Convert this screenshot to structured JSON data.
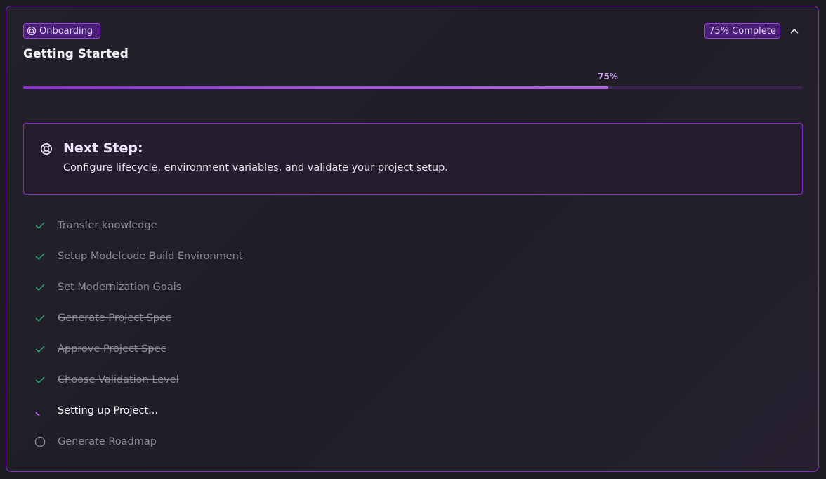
{
  "header": {
    "badge_label": "Onboarding",
    "complete_label": "75% Complete",
    "title": "Getting Started"
  },
  "progress": {
    "value_label": "75%",
    "fraction": 0.75
  },
  "next_step": {
    "title": "Next Step:",
    "description": "Configure lifecycle, environment variables, and validate your project setup."
  },
  "steps": [
    {
      "label": "Transfer knowledge",
      "status": "done",
      "icon": "check-icon"
    },
    {
      "label": "Setup Modelcode Build Environment",
      "status": "done",
      "icon": "check-icon"
    },
    {
      "label": "Set Modernization Goals",
      "status": "done",
      "icon": "check-icon"
    },
    {
      "label": "Generate Project Spec",
      "status": "done",
      "icon": "check-icon"
    },
    {
      "label": "Approve Project Spec",
      "status": "done",
      "icon": "check-icon"
    },
    {
      "label": "Choose Validation Level",
      "status": "done",
      "icon": "check-icon"
    },
    {
      "label": "Setting up Project...",
      "status": "active",
      "icon": "spinner-icon"
    },
    {
      "label": "Generate Roadmap",
      "status": "pending",
      "icon": "circle-icon"
    }
  ],
  "colors": {
    "accent": "#8a2bc9",
    "progress_fill": "#b063ea",
    "check": "#2fa36b",
    "text_muted": "#8d8c95"
  }
}
